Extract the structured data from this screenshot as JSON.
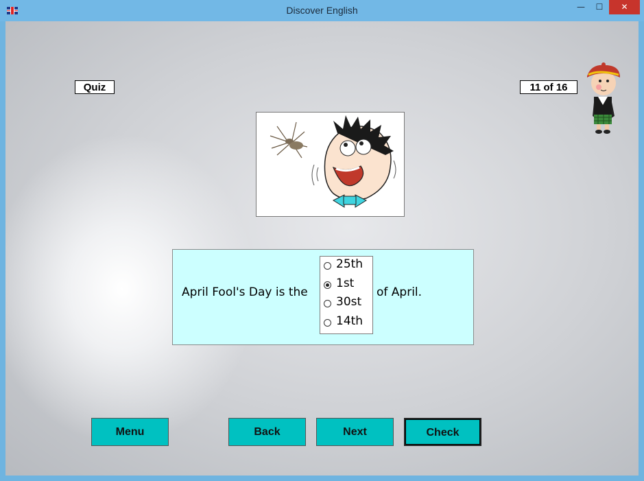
{
  "window": {
    "title": "Discover English",
    "controls": {
      "minimize": "—",
      "maximize": "☐",
      "close": "✕"
    }
  },
  "quiz": {
    "label": "Quiz",
    "progress": "11 of 16"
  },
  "question": {
    "prefix": "April Fool's Day is the",
    "suffix": "of April.",
    "options": [
      "25th",
      "1st",
      "30st",
      "14th"
    ],
    "selected_index": 1
  },
  "buttons": {
    "menu": "Menu",
    "back": "Back",
    "next": "Next",
    "check": "Check"
  },
  "colors": {
    "button": "#00c1c1",
    "question_bg": "#ccffff",
    "titlebar": "#72b8e6",
    "close": "#c7342c"
  },
  "icons": {
    "app": "uk-flag-icon",
    "mascot": "scottish-boy-mascot",
    "picture": "scared-man-spider-picture"
  }
}
